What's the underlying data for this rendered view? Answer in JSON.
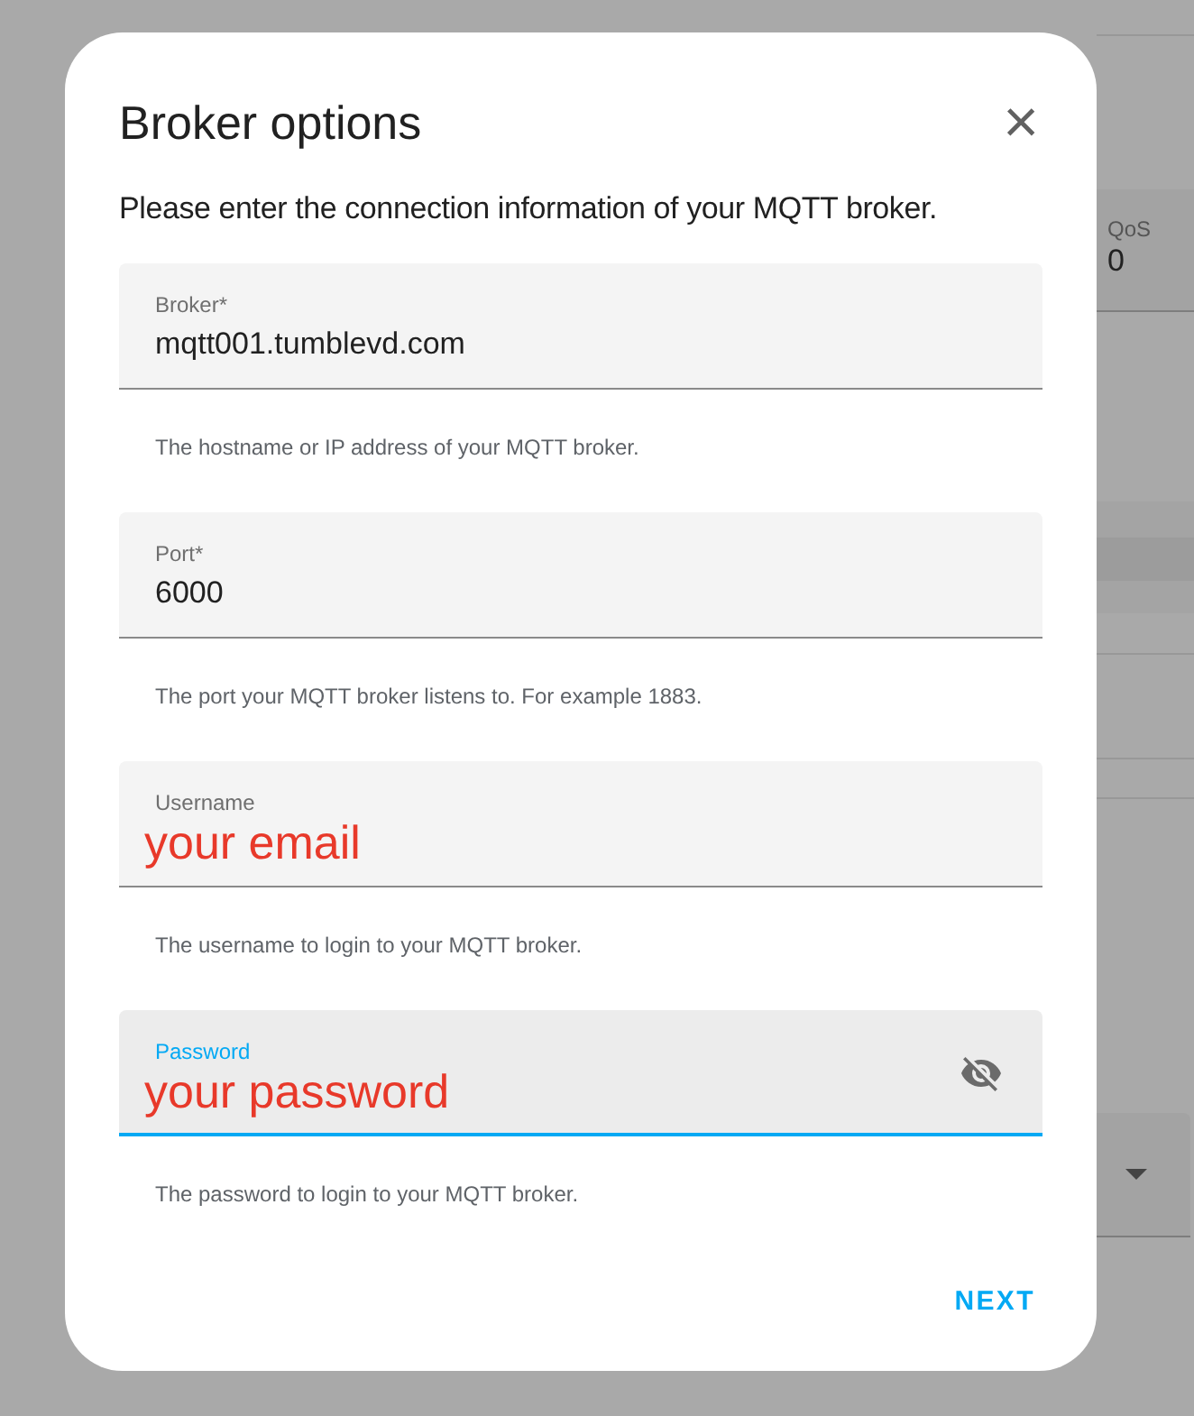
{
  "background": {
    "qos_label": "QoS",
    "qos_value": "0"
  },
  "dialog": {
    "title": "Broker options",
    "close": "×",
    "description": "Please enter the connection information of your MQTT broker.",
    "fields": [
      {
        "label": "Broker*",
        "value": "mqtt001.tumblevd.com",
        "color": "#212121",
        "helper": "The hostname or IP address of your MQTT broker.",
        "focused": false
      },
      {
        "label": "Port*",
        "value": "6000",
        "color": "#212121",
        "helper": "The port your MQTT broker listens to. For example 1883.",
        "focused": false
      },
      {
        "label": "Username",
        "value": "your email",
        "color": "#e8392a",
        "helper": "The username to login to your MQTT broker.",
        "focused": false
      },
      {
        "label": "Password",
        "value": "your password",
        "color": "#e8392a",
        "helper": "The password to login to your MQTT broker.",
        "focused": true,
        "kind": "password"
      }
    ],
    "button": "NEXT"
  }
}
